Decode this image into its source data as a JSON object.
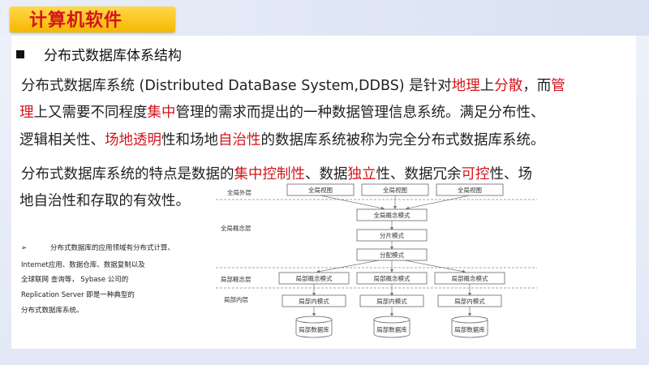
{
  "slide": {
    "title": "计算机软件",
    "subheading": "分布式数据库体系结构"
  },
  "paragraph1": {
    "line1": [
      {
        "text": "分布式数据库系统 (Distributed DataBase System,DDBS) 是针对",
        "hl": false
      },
      {
        "text": "地理",
        "hl": true
      },
      {
        "text": "上",
        "hl": false
      },
      {
        "text": "分散",
        "hl": true
      },
      {
        "text": "，而",
        "hl": false
      },
      {
        "text": "管",
        "hl": true
      }
    ],
    "line2": [
      {
        "text": "理",
        "hl": true
      },
      {
        "text": "上又需要不同程度",
        "hl": false
      },
      {
        "text": "集中",
        "hl": true
      },
      {
        "text": "管理的需求而提出的一种数据管理信息系统。满足分布性、",
        "hl": false
      }
    ],
    "line3": [
      {
        "text": "逻辑相关性、",
        "hl": false
      },
      {
        "text": "场地透明",
        "hl": true
      },
      {
        "text": "性和场地",
        "hl": false
      },
      {
        "text": "自治性",
        "hl": true
      },
      {
        "text": "的数据库系统被称为完全分布式数据库系统。",
        "hl": false
      }
    ]
  },
  "paragraph2": {
    "line1": [
      {
        "text": "分布式数据库系统的特点是数据的",
        "hl": false
      },
      {
        "text": "集中控制性",
        "hl": true
      },
      {
        "text": "、数据",
        "hl": false
      },
      {
        "text": "独立",
        "hl": true
      },
      {
        "text": "性、数据冗余",
        "hl": false
      },
      {
        "text": "可控",
        "hl": true
      },
      {
        "text": "性、场",
        "hl": false
      }
    ],
    "line2": [
      {
        "text": "地自治性和存取的有效性。",
        "hl": false
      }
    ]
  },
  "note": {
    "bullet": "➢",
    "lines": [
      "分布式数据库的应用领域有分布式计算、",
      "Internet应用、数据仓库、数据复制以及",
      "全球联网 查询等， Sybase 公司的",
      "Replication Server 即是一种典型的",
      "分布式数据库系统。"
    ]
  },
  "diagram": {
    "layer_labels": {
      "global_external": "全局外层",
      "global_concept": "全局概念层",
      "local_concept": "局部概念层",
      "local_internal": "局部内层"
    },
    "global_views": [
      "全局视图",
      "全局视图",
      "全局视图"
    ],
    "global_schema": "全局概念模式",
    "fragment_schema": "分片模式",
    "allocation_schema": "分配模式",
    "local_concept_schemas": [
      "局部概念模式",
      "局部概念模式",
      "局部概念模式"
    ],
    "local_internal_schemas": [
      "局部内模式",
      "局部内模式",
      "局部内模式"
    ],
    "local_databases": [
      "局部数据库",
      "局部数据库",
      "局部数据库"
    ]
  },
  "colors": {
    "title_bg": "#f5b800",
    "title_text": "#d4141b",
    "highlight": "#d4141b"
  }
}
